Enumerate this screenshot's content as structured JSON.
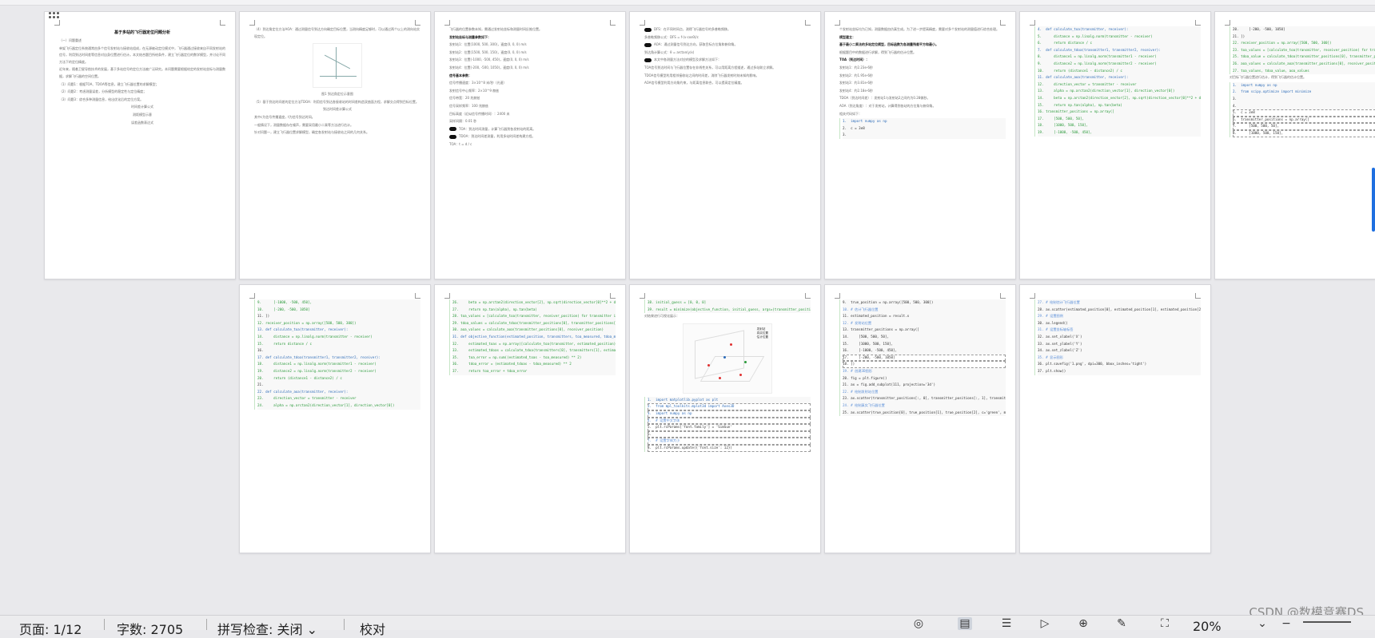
{
  "statusbar": {
    "page": "页面: 1/12",
    "words": "字数: 2705",
    "spellcheck": "拼写检查: 关闭",
    "proofread": "校对",
    "zoom": "20%"
  },
  "watermark": "CSDN @数模竞赛DS",
  "pages": [
    {
      "title": "基于多站的飞行器定位问题分析",
      "paras": [
        "（一）问题重述",
        "单架飞行器定位系统通常由多个信号发射站与接收站组成，在无源被动定位模式中，飞行器通过接收来自不同发射站的信号，利用到达时间差等信息对自身位置进行估计。本文结合题目所给条件，建立飞行器定位的数学模型，并讨论不同方法下的定位精度。",
        "近年来，随着卫星导航技术的发展，基于多站信号的定位方法被广泛研究。本问题需要根据给定的发射站坐标与测量数据，求解飞行器的空间位置。",
        "（1）问题1：根据TOA、TDOA等信息，建立飞行器位置的求解模型；",
        "（2）问题2：考虑测量误差，分析模型的稳定性与定位精度；",
        "（3）问题3：综合多种测量信息，给出优化后的定位方案。"
      ],
      "formulas": [
        "时间差计算公式",
        "测距模型示意",
        "误差函数表达式"
      ]
    },
    {
      "paras": [
        "（4）到达角定位方法AOA：通过测量信号到达方向确定目标位置，当测向精度足够时，可以通过两个以上的测向站实现定位。",
        "图1 到达角定位示意图",
        "（5）基于到达时间差的定位方法TDOA：利用信号到达各接收站的时间差构造双曲面方程，求解交点得到目标位置。",
        "到达时间差计算公式",
        "其中c为信号传播速度，t为信号到达时间。",
        "一般情况下，测量数据存在噪声，需要采用最小二乘等方法进行估计。",
        "针对问题一，建立飞行器位置求解模型，确定各发射站与接收站之间的几何关系。"
      ]
    },
    {
      "paras": [
        "飞行器的位置参数未知，需通过发射站坐标和测量时间反推位置。",
        "发射站坐标与测量参数如下：",
        "发射站1：位置(1000, 500, 300)，速度(0, 0, 0) m/s",
        "发射站2：位置(1500, 500, 150)，速度(0, 0, 0) m/s",
        "发射站3：位置(-1000, -500, 450)，速度(0, 0, 0) m/s",
        "发射站4：位置(-200, -500, 1050)，速度(0, 0, 0) m/s",
        "信号基本参数：",
        "信号传播速度：3×10^8 米/秒（光速）",
        "发射信号中心频率：2×10^9 赫兹",
        "信号带宽：20 兆赫兹",
        "信号采样频率：100 兆赫兹",
        "目标高度（近似信号传播时间）：2400 米",
        "采样间隔：0.01 秒",
        "TOA：到达时间测量，计算飞行器到各发射站的距离。",
        "TDOA：到达时间差测量，利用多站时间差构建方程。",
        "TOA：t = d / c"
      ]
    },
    {
      "paras": [
        "DFS：在不同时间点，测得飞行器信号的多普勒频移。",
        "多普勒频移公式：DFS = f·(v·cosθ)/c",
        "AOA：通过测量信号到达方向，获取目标方位角和俯仰角。",
        "到达角计算公式：θ = arctan(y/x)",
        "本文中各测量方法对应的模型及求解方法如下：",
        "TOA信号到达时间与飞行器位置存在非线性关系，可以用距离方程描述，通过多站联立求解。",
        "TDOA信号模型利用相邻接收站之间的时间差，消除飞行器发射时刻未知的影响。",
        "AOA信号模型利用方向角约束，与距离信息联合，可以提高定位精度。"
      ]
    },
    {
      "paras": [
        "个发射站坐标均为已知，测量数据由仿真生成。为了进一步提高精度，需要对多个发射站的测量值进行综合处理。",
        "模型建立：",
        "基于最小二乘法的多站定位模型，目标函数为各测量残差平方和最小。",
        "根据题目中的数据进行求解，得到飞行器的估计位置。",
        "TOA（到达时间）：",
        "发射站1：约2.23e-6秒",
        "发射站2：约1.95e-6秒",
        "发射站3：约3.81e-6秒",
        "发射站4：约2.18e-6秒",
        "TDOA（到达时间差）：发射站1与发射站2之间约为0.28微秒。",
        "AOA（到达角度）：对于发射站，计算得到各站的方位角与俯仰角。",
        "相关代码如下："
      ],
      "code": [
        "1.  import numpy as np",
        "2.  c = 3e8",
        "3."
      ]
    }
  ],
  "code_pages": [
    [
      "4.  def calculate_toa(transmitter, receiver):",
      "5.      distance = np.linalg.norm(transmitter - receiver)",
      "6.      return distance / c",
      "7.  def calculate_tdoa(transmitter1, transmitter2, receiver):",
      "8.      distance1 = np.linalg.norm(transmitter1 - receiver)",
      "9.      distance2 = np.linalg.norm(transmitter2 - receiver)",
      "10.     return (distance1 - distance2) / c",
      "11. def calculate_aoa(transmitter, receiver):",
      "12.     direction_vector = transmitter - receiver",
      "13.     alpha = np.arctan2(direction_vector[1], direction_vector[0])",
      "14.     beta = np.arctan2(direction_vector[2], np.sqrt(direction_vector[0]**2 + direction_vector[1]**2))",
      "15.     return np.tan(alpha), np.tan(beta)",
      "16. transmitter_positions = np.array([",
      "17.     [500, 500, 50],",
      "18.     [1000, 500, 150],",
      "19.     [-1000, -500, 450],"
    ],
    [
      "20.     [-200, -500, 1050]",
      "21. ])",
      "22. receiver_position = np.array([500, 500, 300])",
      "23. toa_values = [calculate_toa(transmitter, receiver_position) for transmitter in transmitter_positions]",
      "25. tdoa_value = calculate_tdoa(transmitter_positions[0], transmitter_positions[1], receiver_position)",
      "26. aoa_values = calculate_aoa(transmitter_positions[0], receiver_position)",
      "27. toa_values, tdoa_value, aoa_values",
      "对目标飞行器位置进行估计，得到飞行器的估计位置。",
      "1.  import numpy as np",
      "2.  from scipy.optimize import minimize",
      "3.",
      "4.",
      "5.  c = 3e8",
      "6.  transmitter_positions = np.array([",
      "7.      [500, 500, 50],",
      "8.      [1000, 500, 150],"
    ],
    [
      "9.      [-1000, -500, 450],",
      "10.     [-200, -500, 1050]",
      "11. ])",
      "12. receiver_position = np.array([500, 500, 300])",
      "13. def calculate_toa(transmitter, receiver):",
      "14.     distance = np.linalg.norm(transmitter - receiver)",
      "15.     return distance / c",
      "16.",
      "17. def calculate_tdoa(transmitter1, transmitter2, receiver):",
      "18.     distance1 = np.linalg.norm(transmitter1 - receiver)",
      "19.     distance2 = np.linalg.norm(transmitter2 - receiver)",
      "20.     return (distance1 - distance2) / c",
      "21.",
      "22. def calculate_aoa(transmitter, receiver):",
      "23.     direction_vector = transmitter - receiver",
      "24.     alpha = np.arctan2(direction_vector[1], direction_vector[0])"
    ],
    [
      "26.     beta = np.arctan2(direction_vector[2], np.sqrt(direction_vector[0]**2 + direction_vector[1]**2))",
      "27.     return np.tan(alpha), np.tan(beta)",
      "28. toa_values = [calculate_toa(transmitter, receiver_position) for transmitter in transmitter_positions]",
      "29. tdoa_values = calculate_tdoa(transmitter_positions[0], transmitter_positions[1], receiver_position)",
      "30. aoa_values = calculate_aoa(transmitter_positions[0], receiver_position)",
      "31. def objective_function(estimated_position, transmitters, toa_measured, tdoa_measured):",
      "32.     estimated_toas = np.array([calculate_toa(transmitter, estimated_position) for transmitter in transmitters])",
      "33.     estimated_tdoas = calculate_tdoa(transmitters[0], transmitters[1], estimated_position)",
      "35.     toa_error = np.sum((estimated_toas - toa_measured) ** 2)",
      "36.     tdoa_error = (estimated_tdoas - tdoa_measured) ** 2",
      "37.     return toa_error + tdoa_error"
    ]
  ],
  "plot_page": {
    "code_top": [
      "38. initial_guess = [0, 0, 0]",
      "39. result = minimize(objective_function, initial_guess, args=(transmitter_positions, toa_values, tdoa_values))",
      "对结果进行可视化展示："
    ],
    "legend": [
      "发射站",
      "真实位置",
      "估计位置"
    ],
    "code_bottom": [
      "1.  import matplotlib.pyplot as plt",
      "2.  from mpl_toolkits.mplot3d import Axes3D",
      "3.  import numpy as np",
      "4.  # 设置中文字体",
      "5.  plt.rcParams['font.family'] = 'SimSun'",
      "6.",
      "7.  # 设置字体大小",
      "8.  plt.rcParams.update({'font.size': 12})"
    ]
  },
  "page10_code": [
    "9.  true_position = np.array([500, 500, 300])",
    "10. # 估计飞行器位置",
    "11. estimated_position = result.x",
    "12. # 发射站位置",
    "13. transmitter_positions = np.array([",
    "14.     [500, 500, 50],",
    "15.     [1000, 500, 150],",
    "16.     [-1000, -500, 450],",
    "17.     [-200, -500, 1050]",
    "18. ])",
    "19. # 创建3D图形",
    "20. fig = plt.figure()",
    "21. ax = fig.add_subplot(111, projection='3d')",
    "22. # 绘制发射站位置",
    "23. ax.scatter(transmitter_positions[:, 0], transmitter_positions[:, 1], transmitter_positions[:, 2], c='red', marker='^', label='发射站')",
    "24. # 绘制真实飞行器位置",
    "25. ax.scatter(true_position[0], true_position[1], true_position[2], c='green', marker='o', label='真实位置')"
  ],
  "page11_code": [
    "27. # 绘制估计飞行器位置",
    "28. ax.scatter(estimated_position[0], estimated_position[1], estimated_position[2], c='blue', marker='x', label='估计位置')",
    "29. # 设置图例",
    "30. ax.legend()",
    "31. # 设置坐标轴标签",
    "32. ax.set_xlabel('X')",
    "33. ax.set_ylabel('Y')",
    "34. ax.set_zlabel('Z')",
    "35. # 显示图形",
    "36. plt.savefig('1.png', dpi=300, bbox_inches='tight')",
    "37. plt.show()"
  ]
}
